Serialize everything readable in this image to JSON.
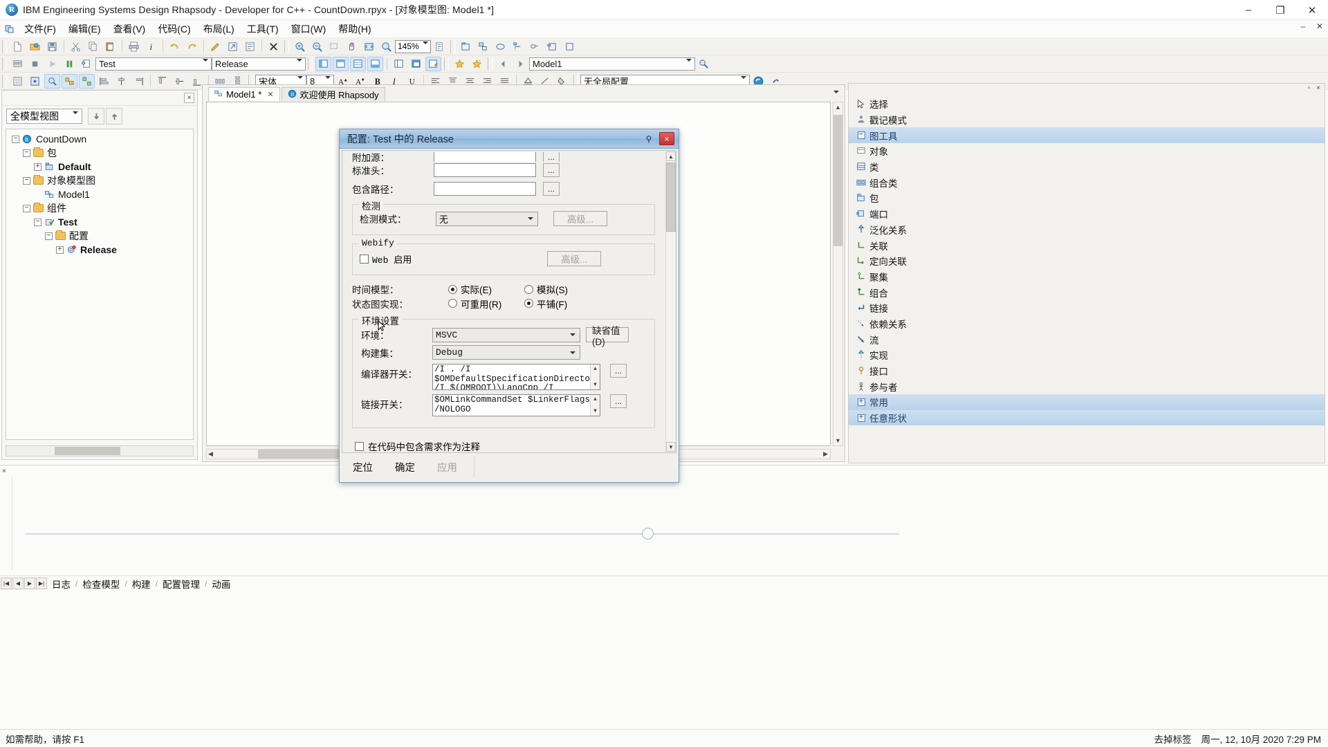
{
  "window": {
    "title": "IBM Engineering Systems Design Rhapsody - Developer for C++ - CountDown.rpyx - [对象模型图: Model1 *]",
    "app_icon": "rhapsody-r-icon",
    "minimize": "–",
    "maximize": "❐",
    "close": "✕",
    "inner_minimize": "–",
    "inner_close": "✕"
  },
  "menu": {
    "items": [
      {
        "label": "文件(F)",
        "name": "menu-file"
      },
      {
        "label": "编辑(E)",
        "name": "menu-edit"
      },
      {
        "label": "查看(V)",
        "name": "menu-view"
      },
      {
        "label": "代码(C)",
        "name": "menu-code"
      },
      {
        "label": "布局(L)",
        "name": "menu-layout"
      },
      {
        "label": "工具(T)",
        "name": "menu-tools"
      },
      {
        "label": "窗口(W)",
        "name": "menu-window"
      },
      {
        "label": "帮助(H)",
        "name": "menu-help"
      }
    ]
  },
  "toolbar": {
    "zoom_value": "145%",
    "config_component": "Test",
    "config_configuration": "Release",
    "active_diagram": "Model1",
    "font_name": "宋体",
    "font_size": "8",
    "global_config": "无全局配置"
  },
  "browser": {
    "view_selector": "全模型视图",
    "tree": [
      {
        "label": "CountDown",
        "depth": 0,
        "icon": "project-icon",
        "expander": "-",
        "bold": false
      },
      {
        "label": "包",
        "depth": 1,
        "icon": "folder-icon",
        "expander": "-",
        "bold": false
      },
      {
        "label": "Default",
        "depth": 2,
        "icon": "package-icon",
        "expander": "+",
        "bold": true
      },
      {
        "label": "对象模型图",
        "depth": 1,
        "icon": "folder-icon",
        "expander": "-",
        "bold": false
      },
      {
        "label": "Model1",
        "depth": 2,
        "icon": "diagram-icon",
        "expander": "",
        "bold": false
      },
      {
        "label": "组件",
        "depth": 1,
        "icon": "folder-icon",
        "expander": "-",
        "bold": false
      },
      {
        "label": "Test",
        "depth": 2,
        "icon": "component-icon",
        "expander": "-",
        "bold": true
      },
      {
        "label": "配置",
        "depth": 3,
        "icon": "folder-icon",
        "expander": "-",
        "bold": false
      },
      {
        "label": "Release",
        "depth": 4,
        "icon": "config-icon",
        "expander": "+",
        "bold": true
      }
    ]
  },
  "editor": {
    "tabs": [
      {
        "label": "Model1 *",
        "active": true,
        "icon": "diagram-icon",
        "closable": true
      },
      {
        "label": "欢迎使用 Rhapsody",
        "active": false,
        "icon": "welcome-icon",
        "closable": false
      }
    ]
  },
  "toolbox": {
    "items": [
      {
        "label": "选择",
        "icon": "pointer-icon",
        "type": "tool"
      },
      {
        "label": "戳记模式",
        "icon": "stamp-icon",
        "type": "tool"
      },
      {
        "label": "图工具",
        "icon": "collapse-icon",
        "type": "header"
      },
      {
        "label": "对象",
        "icon": "object-icon",
        "type": "tool"
      },
      {
        "label": "类",
        "icon": "class-icon",
        "type": "tool"
      },
      {
        "label": "组合类",
        "icon": "composite-class-icon",
        "type": "tool"
      },
      {
        "label": "包",
        "icon": "package-icon",
        "type": "tool"
      },
      {
        "label": "端口",
        "icon": "port-icon",
        "type": "tool"
      },
      {
        "label": "泛化关系",
        "icon": "generalization-icon",
        "type": "tool"
      },
      {
        "label": "关联",
        "icon": "association-icon",
        "type": "tool"
      },
      {
        "label": "定向关联",
        "icon": "directed-association-icon",
        "type": "tool"
      },
      {
        "label": "聚集",
        "icon": "aggregation-icon",
        "type": "tool"
      },
      {
        "label": "组合",
        "icon": "composition-icon",
        "type": "tool"
      },
      {
        "label": "链接",
        "icon": "link-icon",
        "type": "tool"
      },
      {
        "label": "依赖关系",
        "icon": "dependency-icon",
        "type": "tool"
      },
      {
        "label": "流",
        "icon": "flow-icon",
        "type": "tool"
      },
      {
        "label": "实现",
        "icon": "realization-icon",
        "type": "tool"
      },
      {
        "label": "接口",
        "icon": "interface-icon",
        "type": "tool"
      },
      {
        "label": "参与者",
        "icon": "actor-icon",
        "type": "tool"
      },
      {
        "label": "常用",
        "icon": "expand-icon",
        "type": "header"
      },
      {
        "label": "任意形状",
        "icon": "expand-icon",
        "type": "header"
      }
    ]
  },
  "output_panel": {
    "tabs": [
      {
        "label": "日志",
        "active": true
      },
      {
        "label": "检查模型",
        "active": false
      },
      {
        "label": "构建",
        "active": false
      },
      {
        "label": "配置管理",
        "active": false
      },
      {
        "label": "动画",
        "active": false
      }
    ]
  },
  "statusbar": {
    "hint": "如需帮助，请按 F1",
    "tag_info": "去掉标签",
    "datetime": "周一, 12, 10月 2020  7:29 PM"
  },
  "dialog": {
    "title": "配置: Test 中的 Release",
    "pin_icon": "pin-icon",
    "close_icon": "close-icon",
    "fields": {
      "additional_sources_label": "附加源：",
      "additional_sources_value": "",
      "standard_headers_label": "标准头：",
      "standard_headers_value": "",
      "include_path_label": "包含路径：",
      "include_path_value": "",
      "browse_label": "..."
    },
    "instrumentation": {
      "group_label": "检测",
      "mode_label": "检测模式：",
      "mode_value": "无",
      "advanced_label": "高级..."
    },
    "webify": {
      "group_label": "Webify",
      "enable_label": "Web 启用",
      "enable_checked": false,
      "advanced_label": "高级..."
    },
    "time_model": {
      "label": "时间模型：",
      "options": [
        {
          "label": "实际(E)",
          "selected": true
        },
        {
          "label": "模拟(S)",
          "selected": false
        }
      ]
    },
    "statechart": {
      "label": "状态图实现：",
      "options": [
        {
          "label": "可重用(R)",
          "selected": false
        },
        {
          "label": "平铺(F)",
          "selected": true
        }
      ]
    },
    "environment": {
      "group_label": "环境设置",
      "env_label": "环境：",
      "env_value": "MSVC",
      "default_button": "缺省值(D)",
      "buildset_label": "构建集：",
      "buildset_value": "Debug",
      "compiler_switches_label": "编译器开关：",
      "compiler_switches_value": "/I . /I\n$OMDefaultSpecificationDirectory\n/I $(OMROOT)\\LangCpp /I",
      "linker_switches_label": "链接开关：",
      "linker_switches_value": "$OMLinkCommandSet $LinkerFlags\n/NOLOGO",
      "browse_label": "..."
    },
    "include_requirements": {
      "label": "在代码中包含需求作为注释",
      "checked": false
    },
    "footer": {
      "locate": "定位",
      "ok": "确定",
      "apply": "应用",
      "apply_disabled": true
    }
  }
}
